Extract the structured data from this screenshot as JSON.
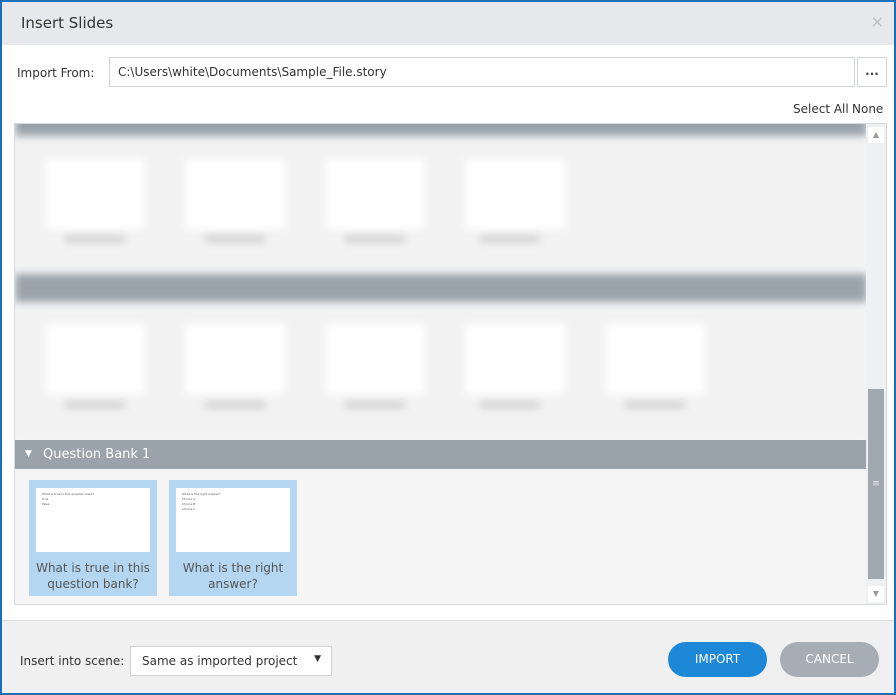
{
  "window": {
    "title": "Insert Slides",
    "close_icon": "×"
  },
  "import": {
    "label": "Import From:",
    "path": "C:\\Users\\white\\Documents\\Sample_File.story",
    "browse_label": "..."
  },
  "selection": {
    "select_all": "Select All",
    "none": "None"
  },
  "question_bank": {
    "title": "Question Bank 1",
    "slides": [
      {
        "caption": "What is true in this question bank?",
        "preview_lines": [
          "What is true in this question bank?",
          "True",
          "False"
        ]
      },
      {
        "caption": "What is the right answer?",
        "preview_lines": [
          "What is the right answer?",
          "Choice A",
          "Choice B",
          "Choice C"
        ]
      }
    ]
  },
  "footer": {
    "insert_label": "Insert into scene:",
    "scene_value": "Same as imported project",
    "import": "IMPORT",
    "cancel": "CANCEL"
  },
  "colors": {
    "accent": "#1e88d8",
    "border": "#1a6fb8",
    "header": "#9aa3ab",
    "selected": "#b5d6f0"
  }
}
